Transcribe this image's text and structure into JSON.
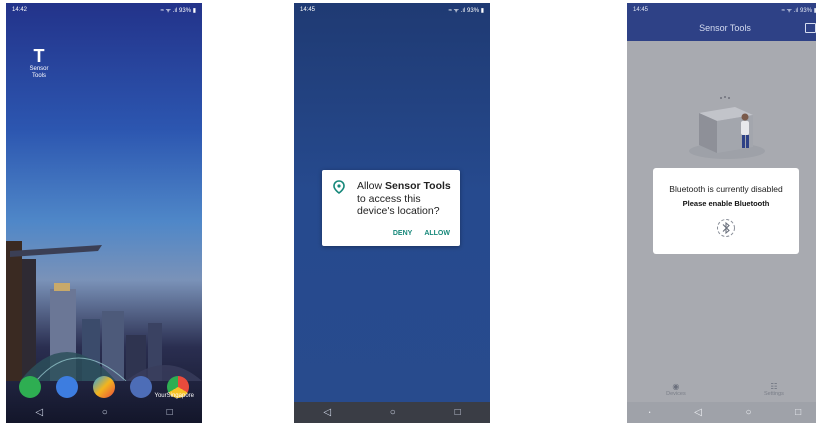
{
  "phone1": {
    "status_time": "14:42",
    "status_icons": "≈ ᯤ .ıl 93% ▮",
    "app_label": "Sensor Tools",
    "dock_apps": [
      "phone-app",
      "messages-app",
      "play-store-app",
      "camera-app",
      "chrome-app"
    ],
    "watermark": "YourSingapore"
  },
  "phone2": {
    "status_time": "14:45",
    "status_icons": "≈ ᯤ .ıl 93% ▮",
    "dialog": {
      "text_prefix": "Allow ",
      "app_name": "Sensor Tools",
      "text_suffix": " to access this device's location?",
      "deny": "DENY",
      "allow": "ALLOW"
    }
  },
  "phone3": {
    "status_time": "14:45",
    "status_icons": "≈ ᯤ .ıl 93% ▮",
    "app_title": "Sensor Tools",
    "message_line1": "Bluetooth is currently disabled",
    "message_line2": "Please enable Bluetooth",
    "tabs": [
      {
        "label": "Devices",
        "icon": "devices-icon"
      },
      {
        "label": "Settings",
        "icon": "settings-icon"
      }
    ]
  },
  "colors": {
    "app_bar": "#2e4186",
    "dialog_accent": "#16887a",
    "overlay": "#a8aab0"
  }
}
